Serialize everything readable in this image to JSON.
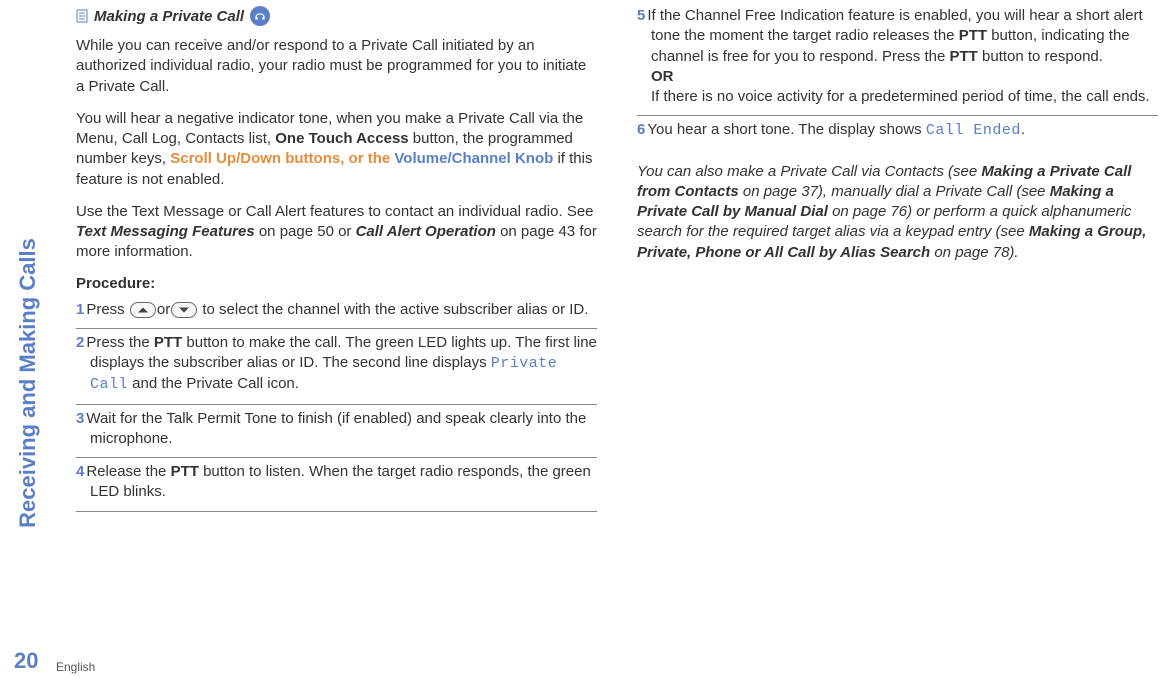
{
  "sidebar": {
    "section_label": "Receiving and Making Calls",
    "page_number": "20",
    "language": "English"
  },
  "title": "Making a Private Call",
  "para1_a": "While you can receive and/or respond to a Private Call initiated by an authorized individual radio, your radio must be programmed for you to initiate a Private Call.",
  "para2_a": "You will hear a negative indicator tone, when you make a Private Call via the Menu, Call Log, Contacts list, ",
  "para2_b": "One Touch Access",
  "para2_c": " button, the programmed number keys, ",
  "para2_d": "Scroll Up/Down",
  "para2_e": " buttons, or the ",
  "para2_f": "Volume/Channel Knob",
  "para2_g": " if this feature is not enabled.",
  "para3_a": "Use the Text Message or Call Alert features to contact an individual radio. See ",
  "para3_b": "Text Messaging Features",
  "para3_c": " on page 50 or ",
  "para3_d": "Call Alert Operation",
  "para3_e": " on page 43 for more information.",
  "procedure_label": "Procedure:",
  "steps": {
    "s1": {
      "num": "1",
      "a": "Press ",
      "b": "or",
      "c": " to select the channel with the active subscriber alias or ID."
    },
    "s2": {
      "num": "2",
      "a": "Press the ",
      "b": "PTT",
      "c": " button to make the call. The green LED lights up. The first line displays the subscriber alias or ID. The second line displays ",
      "d": "Private Call",
      "e": " and the Private Call icon."
    },
    "s3": {
      "num": "3",
      "a": "Wait for the Talk Permit Tone to finish (if enabled) and speak clearly into the microphone."
    },
    "s4": {
      "num": "4",
      "a": "Release the ",
      "b": "PTT",
      "c": " button to listen. When the target radio responds, the green LED blinks."
    },
    "s5": {
      "num": "5",
      "a": "If the Channel Free Indication feature is enabled, you will hear a short alert tone the moment the target radio releases the ",
      "b": "PTT",
      "c": " button, indicating the channel is free for you to respond. Press the ",
      "d": "PTT",
      "e": " button to respond.",
      "or": "OR",
      "f": "If there is no voice activity for a predetermined period of time, the call ends."
    },
    "s6": {
      "num": "6",
      "a": "You hear a short tone. The display shows ",
      "b": "Call Ended",
      "c": "."
    }
  },
  "footnote": {
    "a": "You can also make a Private Call via Contacts (see ",
    "b": "Making a Private Call from Contacts",
    "c": " on page 37), manually dial a Private Call (see ",
    "d": "Making a Private Call by Manual Dial",
    "e": " on page 76) or perform a quick alphanumeric search for the required target alias via a keypad entry (see ",
    "f": "Making a Group, Private, Phone or All Call by Alias Search",
    "g": " on page 78)."
  }
}
